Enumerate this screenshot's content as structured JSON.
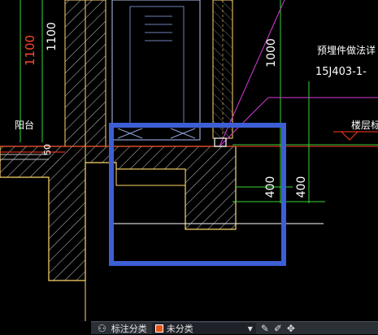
{
  "drawing": {
    "dim_1100_red": "1100",
    "dim_1100_white": "1100",
    "dim_1000": "1000",
    "balcony_label": "阳台",
    "dim_50": "50",
    "embed_note_line1": "预埋件做法详",
    "embed_note_line2": "15J403-1-",
    "floor_elev_label": "楼层标",
    "dim_400_inner": "400",
    "dim_400_outer": "400"
  },
  "toolbar": {
    "layer_label": "标注分类",
    "layer_value": "未分类",
    "layer_color": "#e2561b",
    "icons": [
      "binoculars-icon",
      "pencil-icon",
      "edit-icon",
      "move-icon"
    ]
  },
  "colors": {
    "highlight_box": "#3d5fd6",
    "wall": "#ffd76a",
    "dimension": "#39d339",
    "leader": "#d63ad6",
    "axis": "#ff3a1f"
  }
}
